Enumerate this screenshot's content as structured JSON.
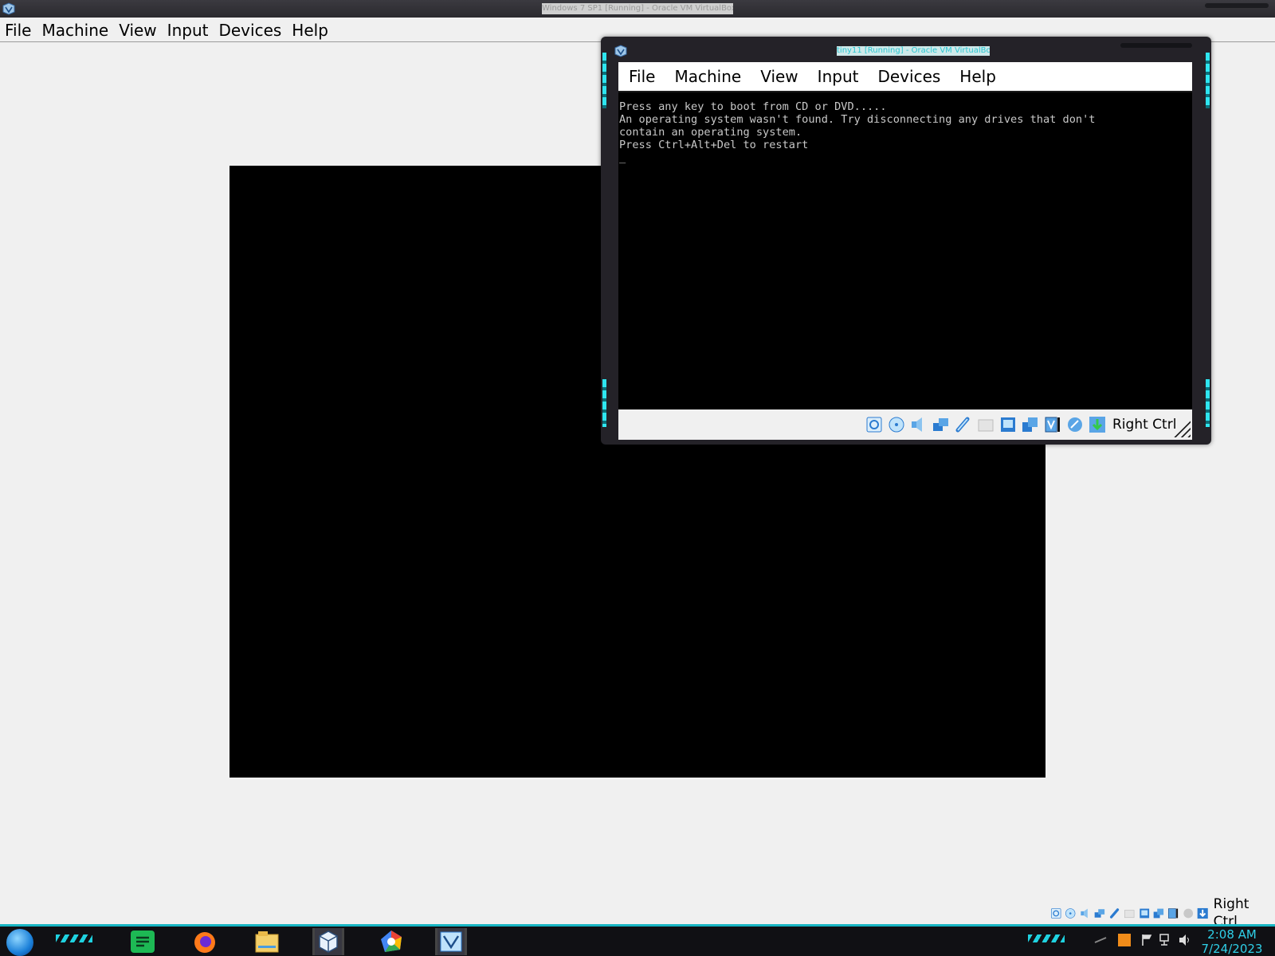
{
  "outer_window": {
    "title": "Windows 7 SP1 [Running] - Oracle VM VirtualBox",
    "menu": [
      "File",
      "Machine",
      "View",
      "Input",
      "Devices",
      "Help"
    ],
    "host_key": "Right Ctrl"
  },
  "inner_window": {
    "title": "tiny11 [Running] - Oracle VM VirtualBox",
    "menu": [
      "File",
      "Machine",
      "View",
      "Input",
      "Devices",
      "Help"
    ],
    "boot_text": "Press any key to boot from CD or DVD.....\nAn operating system wasn't found. Try disconnecting any drives that don't\ncontain an operating system.\nPress Ctrl+Alt+Del to restart\n_",
    "host_key": "Right Ctrl"
  },
  "status_icons": [
    "hard-disk-icon",
    "optical-drive-icon",
    "audio-icon",
    "network-icon",
    "usb-icon",
    "shared-folders-icon",
    "display-icon",
    "recording-icon",
    "virtualization-icon",
    "mouse-integration-icon",
    "host-key-arrow-icon"
  ],
  "taskbar": {
    "apps": [
      "spotify-icon",
      "firefox-icon",
      "file-explorer-icon",
      "virtualbox-icon",
      "chrome-icon",
      "virtualbox-vm-icon"
    ],
    "clock_time": "2:08 AM",
    "clock_date": "7/24/2023"
  },
  "colors": {
    "accent": "#17b6c4",
    "clock": "#2fd0e8"
  }
}
